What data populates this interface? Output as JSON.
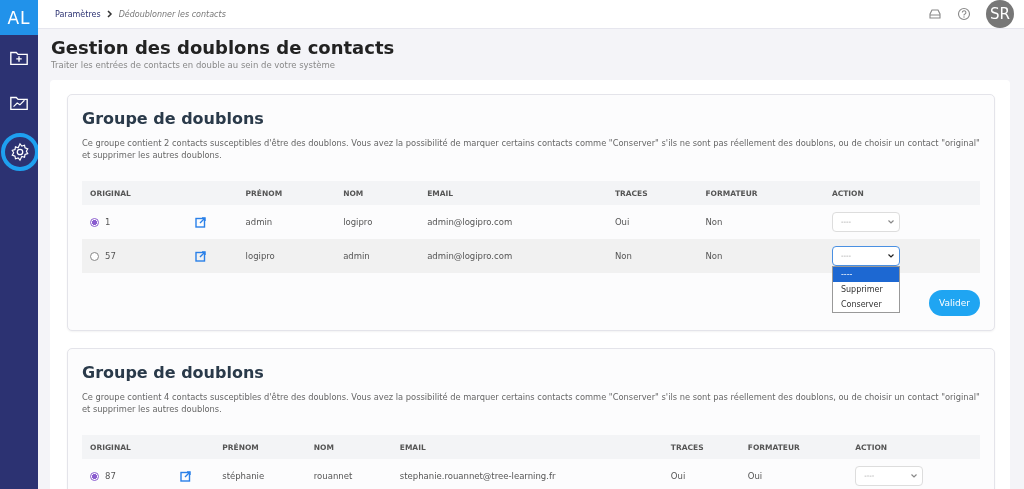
{
  "logo": {
    "text": "AL"
  },
  "sidebar": {
    "items": [
      {
        "kind": "folder-plus",
        "selected": false
      },
      {
        "kind": "folder-chart",
        "selected": false
      },
      {
        "kind": "settings",
        "selected": true
      }
    ]
  },
  "breadcrumb": {
    "items": [
      "Paramètres",
      "Dédoublonner les contacts"
    ]
  },
  "header": {
    "avatar": "SR"
  },
  "page": {
    "title": "Gestion des doublons de contacts",
    "subtitle": "Traiter les entrées de contacts en double au sein de votre système"
  },
  "groups": [
    {
      "title": "Groupe de doublons",
      "description": "Ce groupe contient 2 contacts susceptibles d'être des doublons. Vous avez la possibilité de marquer certains contacts comme \"Conserver\" s'ils ne sont pas réellement des doublons, ou de choisir un contact \"original\" et supprimer les autres doublons.",
      "columns": [
        "ORIGINAL",
        "",
        "PRÉNOM",
        "NOM",
        "EMAIL",
        "TRACES",
        "FORMATEUR",
        "ACTION"
      ],
      "rows": [
        {
          "selected": true,
          "highlighted": false,
          "id": "1",
          "prenom": "admin",
          "nom": "logipro",
          "email": "admin@logipro.com",
          "traces": "Oui",
          "formateur": "Non",
          "action": {
            "value": "----",
            "open": false
          }
        },
        {
          "selected": false,
          "highlighted": true,
          "id": "57",
          "prenom": "logipro",
          "nom": "admin",
          "email": "admin@logipro.com",
          "traces": "Non",
          "formateur": "Non",
          "action": {
            "value": "----",
            "open": true,
            "options": [
              {
                "label": "----",
                "selected": true
              },
              {
                "label": "Supprimer",
                "selected": false
              },
              {
                "label": "Conserver",
                "selected": false
              }
            ]
          }
        }
      ],
      "button": "Valider"
    },
    {
      "title": "Groupe de doublons",
      "description": "Ce groupe contient 4 contacts susceptibles d'être des doublons. Vous avez la possibilité de marquer certains contacts comme \"Conserver\" s'ils ne sont pas réellement des doublons, ou de choisir un contact \"original\" et supprimer les autres doublons.",
      "columns": [
        "ORIGINAL",
        "",
        "PRÉNOM",
        "NOM",
        "EMAIL",
        "TRACES",
        "FORMATEUR",
        "ACTION"
      ],
      "rows": [
        {
          "selected": true,
          "highlighted": false,
          "id": "87",
          "prenom": "stéphanie",
          "nom": "rouannet",
          "email": "stephanie.rouannet@tree-learning.fr",
          "traces": "Oui",
          "formateur": "Oui",
          "action": {
            "value": "----",
            "open": false
          }
        }
      ]
    }
  ]
}
